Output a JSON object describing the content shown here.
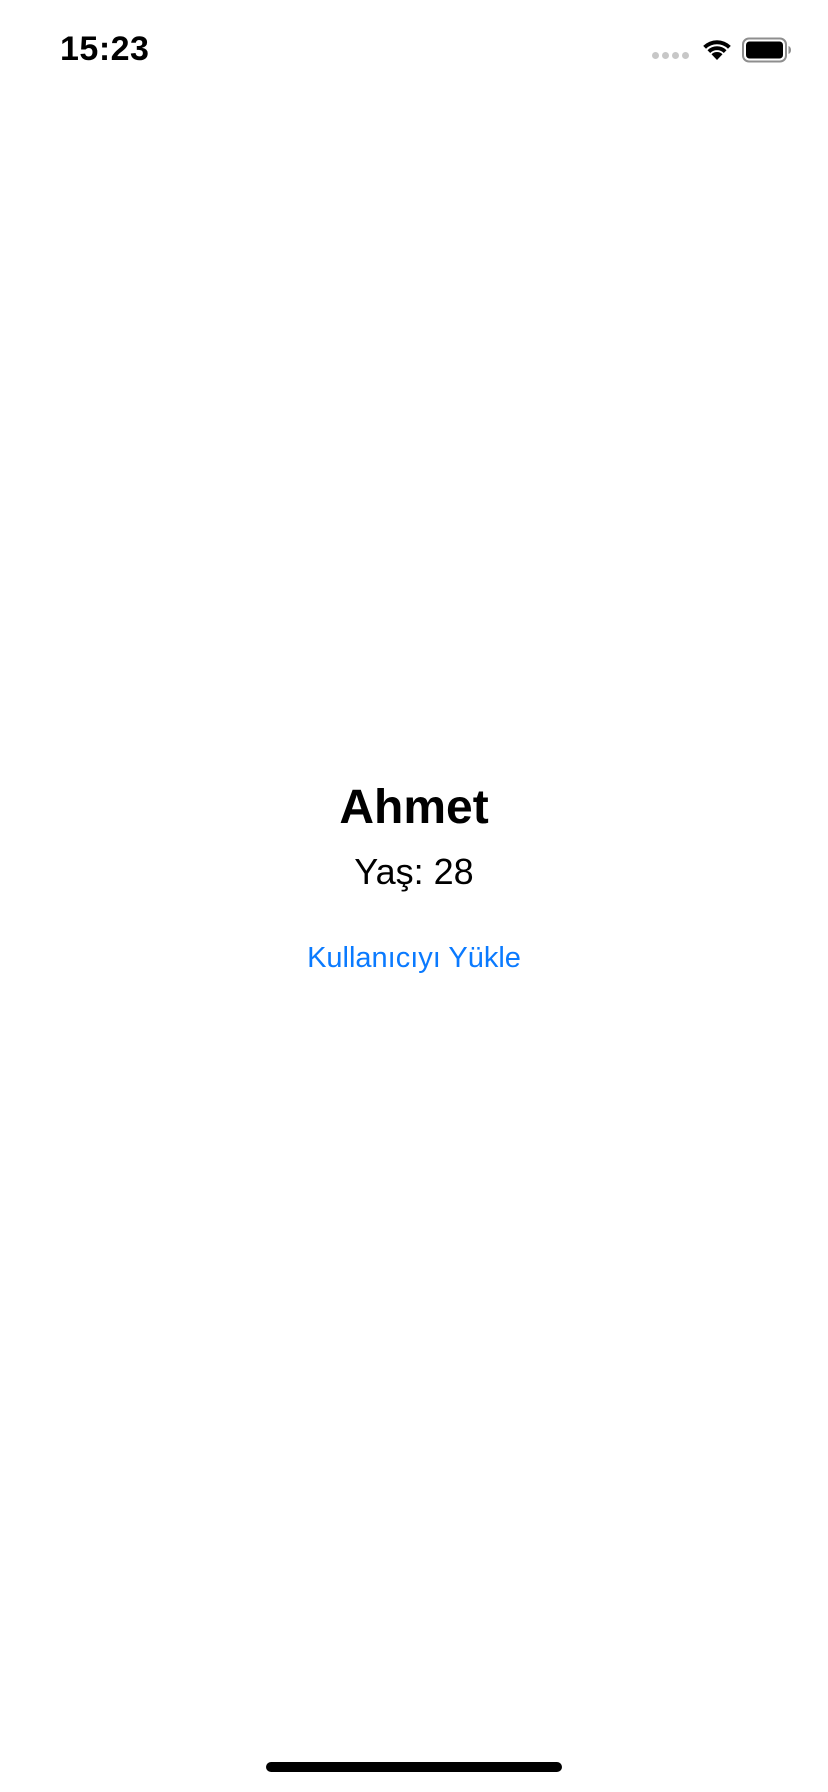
{
  "status_bar": {
    "time": "15:23",
    "signal_icon": "cellular-signal-icon",
    "wifi_icon": "wifi-icon",
    "battery_icon": "battery-icon"
  },
  "profile": {
    "name": "Ahmet",
    "age_label": "Yaş: 28"
  },
  "actions": {
    "load_user_label": "Kullanıcıyı Yükle"
  },
  "colors": {
    "accent": "#0a7aff",
    "background": "#ffffff",
    "text": "#000000"
  }
}
